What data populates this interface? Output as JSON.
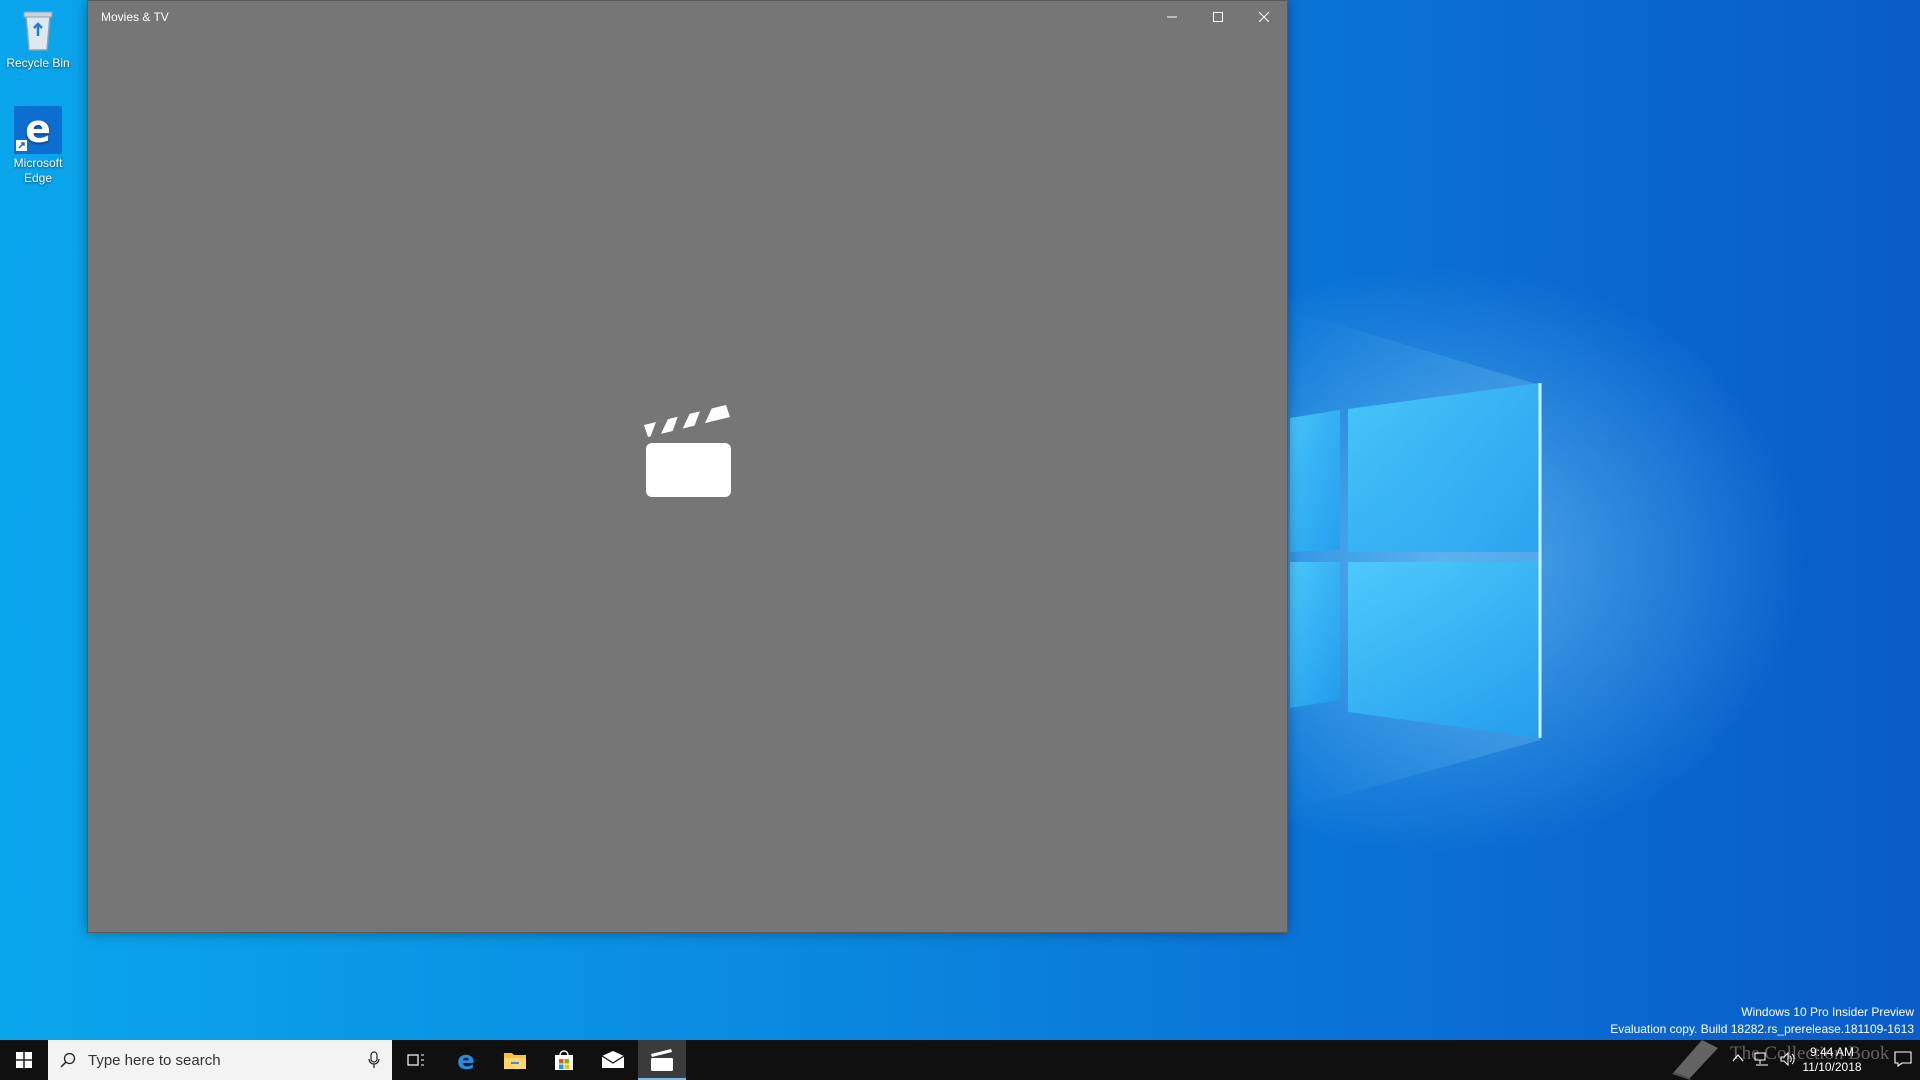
{
  "desktop": {
    "icons": [
      {
        "label": "Recycle Bin"
      },
      {
        "label": "Microsoft Edge"
      }
    ]
  },
  "window": {
    "title": "Movies & TV"
  },
  "watermark": {
    "line1": "Windows 10 Pro Insider Preview",
    "line2": "Evaluation copy. Build 18282.rs_prerelease.181109-1613"
  },
  "taskbar": {
    "search_placeholder": "Type here to search",
    "pinned": [
      "Task View",
      "Microsoft Edge",
      "File Explorer",
      "Microsoft Store",
      "Mail",
      "Movies & TV"
    ],
    "active": "Movies & TV",
    "clock_time": "9:44 AM",
    "clock_date": "11/10/2018",
    "overlay_text": "The Collection Book"
  },
  "colors": {
    "window_bg": "#767676",
    "taskbar_bg": "#101010",
    "accent": "#0078d7"
  }
}
